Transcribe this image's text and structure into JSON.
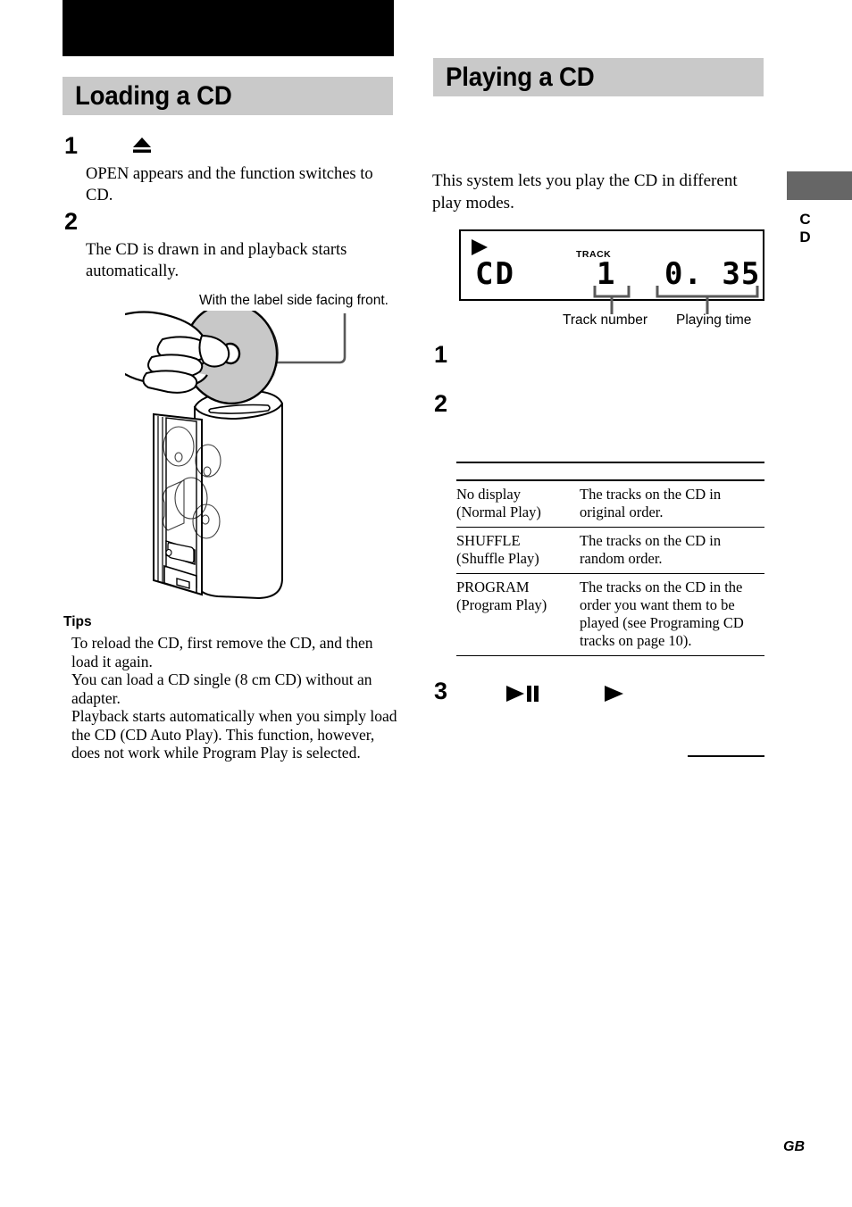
{
  "page": {
    "footer_marker": "GB",
    "edge_tab_label": "CD",
    "edge_tab_color": "#666666",
    "heading_bar_color": "#c9c9c9",
    "header_bar_color": "#000000"
  },
  "left_column": {
    "heading": "Loading a CD",
    "steps": [
      {
        "number": "1",
        "icon": "eject-icon",
        "text": "OPEN   appears and the function switches to CD."
      },
      {
        "number": "2",
        "text": "The CD is drawn in and playback starts automatically."
      }
    ],
    "illustration": {
      "callout": "With the label side facing front.",
      "alt": "hand-loading-cd-into-vertical-player"
    },
    "tips": {
      "heading": "Tips",
      "items": [
        "To reload the CD, first remove the CD, and then load it again.",
        "You can load a CD single (8 cm CD) without an adapter.",
        "Playback starts automatically when you simply load the CD (CD Auto Play). This function, however, does not work while Program Play is selected."
      ]
    }
  },
  "right_column": {
    "heading": "Playing a CD",
    "intro": "This system lets you play the CD in different play modes.",
    "display": {
      "play_indicator": "▶",
      "source": "CD",
      "track_label": "TRACK",
      "track_number": "1",
      "playing_time": "0. 35",
      "leader_labels": {
        "track": "Track number",
        "time": "Playing time"
      }
    },
    "steps": [
      {
        "number": "1",
        "text": ""
      },
      {
        "number": "2",
        "text": ""
      },
      {
        "number": "3",
        "text": "",
        "icons": [
          "play-pause-icon",
          "play-icon"
        ]
      }
    ],
    "mode_table": {
      "col1_header": "",
      "col2_header": "",
      "rows": [
        {
          "mode": "No display\n(Normal Play)",
          "mode_line1": "No display",
          "mode_line2": "(Normal Play)",
          "description": "The tracks on the CD in original order."
        },
        {
          "mode": "SHUFFLE\n(Shuffle Play)",
          "mode_line1": "SHUFFLE",
          "mode_line2": "(Shuffle Play)",
          "description": "The tracks on the CD in random order."
        },
        {
          "mode": "PROGRAM\n(Program Play)",
          "mode_line1": "PROGRAM",
          "mode_line2": "(Program Play)",
          "description": "The tracks on the CD in the order you want them to be played (see  Programing CD tracks  on page 10)."
        }
      ]
    }
  }
}
